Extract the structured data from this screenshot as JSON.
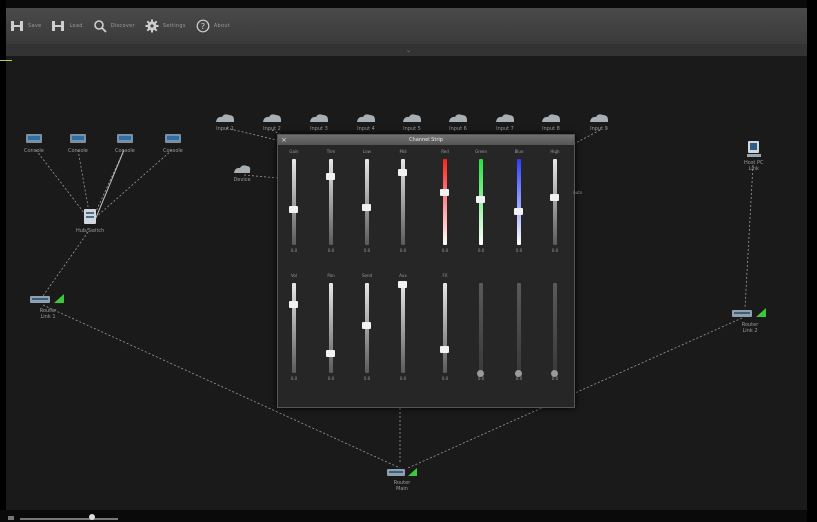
{
  "toolbar": {
    "tools": [
      {
        "label": "Save",
        "icon": "network-save-icon"
      },
      {
        "label": "Load",
        "icon": "network-load-icon"
      },
      {
        "label": "Discover",
        "icon": "search-icon"
      },
      {
        "label": "Settings",
        "icon": "gear-icon"
      },
      {
        "label": "About",
        "icon": "help-icon"
      }
    ]
  },
  "subbar": {
    "handle": "⌄"
  },
  "nodes": {
    "consoles": [
      {
        "label": "Console"
      },
      {
        "label": "Console"
      },
      {
        "label": "Console"
      },
      {
        "label": "Console"
      }
    ],
    "hub": {
      "label": "Hub/Switch"
    },
    "left_router": {
      "line1": "Router",
      "line2": "Link 1"
    },
    "top_row": [
      {
        "label": "Input 1"
      },
      {
        "label": "Input 2"
      },
      {
        "label": "Input 3"
      },
      {
        "label": "Input 4"
      },
      {
        "label": "Input 5"
      },
      {
        "label": "Input 6"
      },
      {
        "label": "Input 7"
      },
      {
        "label": "Input 8"
      },
      {
        "label": "Input 9"
      }
    ],
    "small_device": {
      "label": "Device"
    },
    "right_pc": {
      "line1": "Host PC",
      "line2": "Link"
    },
    "right_router": {
      "line1": "Router",
      "line2": "Link 2"
    },
    "bottom_router": {
      "line1": "Router",
      "line2": "Main"
    }
  },
  "dialog": {
    "title": "Channel Strip",
    "close": "×",
    "side_hint": "Auto",
    "row1": [
      {
        "label": "Gain",
        "value": "0.0",
        "level": 0.42,
        "color": "#dddddd"
      },
      {
        "label": "Trim",
        "value": "0.0",
        "level": 0.8,
        "color": "#dddddd"
      },
      {
        "label": "Low",
        "value": "0.0",
        "level": 0.44,
        "color": "#dddddd"
      },
      {
        "label": "Mid",
        "value": "0.0",
        "level": 0.85,
        "color": "#dddddd"
      },
      {
        "label": "Red",
        "value": "0.0",
        "level": 0.62,
        "color": "#ff2020"
      },
      {
        "label": "Green",
        "value": "0.0",
        "level": 0.54,
        "color": "#22e23a"
      },
      {
        "label": "Blue",
        "value": "0.0",
        "level": 0.4,
        "color": "#2d3cff"
      },
      {
        "label": "High",
        "value": "0.0",
        "level": 0.56,
        "color": "#dddddd"
      }
    ],
    "row2": [
      {
        "label": "Vol",
        "value": "0.0",
        "level": 0.77,
        "color": "#dddddd",
        "round": false
      },
      {
        "label": "Pan",
        "value": "0.0",
        "level": 0.22,
        "color": "#dddddd",
        "round": false
      },
      {
        "label": "Send",
        "value": "0.0",
        "level": 0.53,
        "color": "#dddddd",
        "round": false
      },
      {
        "label": "Aux",
        "value": "0.0",
        "level": 0.99,
        "color": "#dddddd",
        "round": false
      },
      {
        "label": "FX",
        "value": "0.0",
        "level": 0.27,
        "color": "#dddddd",
        "round": false
      },
      {
        "label": "",
        "value": "0.0",
        "level": 0.0,
        "color": "#777777",
        "round": true
      },
      {
        "label": "",
        "value": "0.0",
        "level": 0.0,
        "color": "#777777",
        "round": true
      },
      {
        "label": "",
        "value": "0.0",
        "level": 0.0,
        "color": "#777777",
        "round": true
      }
    ]
  },
  "zoom": {
    "level": 0.73
  }
}
